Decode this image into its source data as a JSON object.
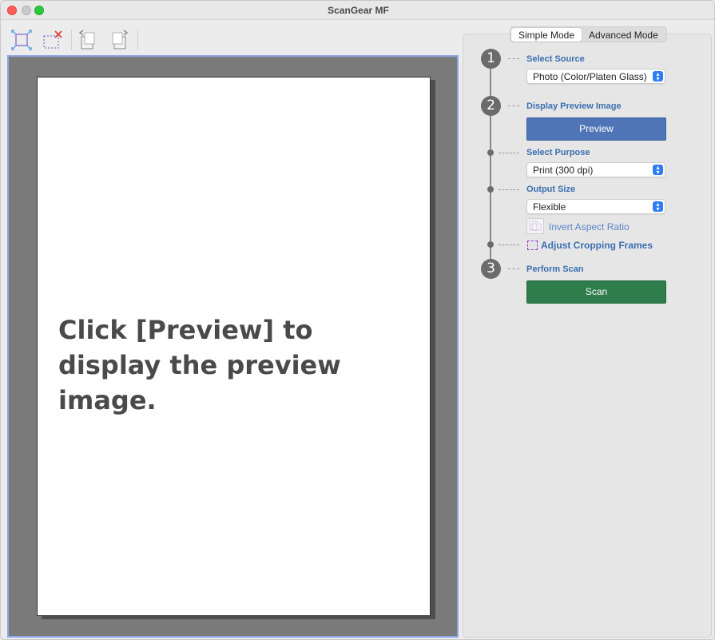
{
  "window": {
    "title": "ScanGear MF"
  },
  "toolbar": {
    "buttons": [
      {
        "icon": "auto-crop-icon"
      },
      {
        "icon": "remove-crop-frame-icon"
      },
      {
        "icon": "rotate-left-icon"
      },
      {
        "icon": "rotate-right-icon"
      }
    ]
  },
  "preview": {
    "message": "Click [Preview] to display the preview image."
  },
  "mode_tabs": [
    {
      "label": "Simple Mode",
      "active": true
    },
    {
      "label": "Advanced Mode",
      "active": false
    }
  ],
  "steps": {
    "step1": {
      "number": "1",
      "label": "Select Source",
      "value": "Photo (Color/Platen Glass)"
    },
    "step2": {
      "number": "2",
      "label": "Display Preview Image",
      "button": "Preview"
    },
    "purpose": {
      "label": "Select Purpose",
      "value": "Print (300 dpi)"
    },
    "output": {
      "label": "Output Size",
      "value": "Flexible",
      "invert_label": "Invert Aspect Ratio",
      "adjust_label": "Adjust Cropping Frames"
    },
    "step3": {
      "number": "3",
      "label": "Perform Scan",
      "button": "Scan"
    }
  },
  "colors": {
    "accent_blue": "#3b6fb0",
    "preview_button": "#5075b6",
    "scan_button": "#2e7d4a",
    "dropdown_arrow": "#2f7cf6"
  }
}
